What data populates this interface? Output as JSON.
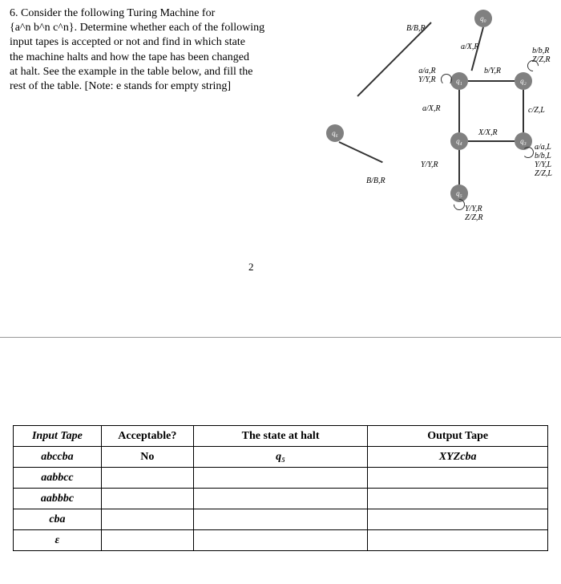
{
  "question": {
    "number": "6.",
    "text_l1": "Consider the following Turing Machine for",
    "text_l2": "{a^n b^n c^n}. Determine whether each of the following",
    "text_l3": "input tapes is accepted or not and find in which state",
    "text_l4": "the machine halts and how the tape has been changed",
    "text_l5": "at halt. See the example in the table below, and fill the",
    "text_l6": "rest of the table. [Note: e stands for empty string]"
  },
  "states": {
    "q0": "q₀",
    "q1": "q₁",
    "q2": "q₂",
    "q3": "q₃",
    "q4": "q₄",
    "q5": "q₅",
    "q6": "q₆"
  },
  "transitions": {
    "t_bbr_top": "B/B,R",
    "t_axr_top": "a/X,R",
    "t_q1_loop_a": "a/a,R",
    "t_q1_loop_b": "Y/Y,R",
    "t_byr": "b/Y,R",
    "t_q2_loop_a": "b/b,R",
    "t_q2_loop_b": "Z/Z,R",
    "t_czl": "c/Z,L",
    "t_q3_loop_a": "a/a,L",
    "t_q3_loop_b": "b/b,L",
    "t_q3_loop_c": "Y/Y,L",
    "t_q3_loop_d": "Z/Z,L",
    "t_xxr": "X/X,R",
    "t_axr_mid": "a/X,R",
    "t_yyr_mid": "Y/Y,R",
    "t_q5_loop_a": "Y/Y,R",
    "t_q5_loop_b": "Z/Z,R",
    "t_bbr_bot": "B/B,R"
  },
  "page_number": "2",
  "table": {
    "headers": {
      "input": "Input Tape",
      "accept": "Acceptable?",
      "state": "The state at halt",
      "output": "Output Tape"
    },
    "rows": [
      {
        "input": "abccba",
        "accept": "No",
        "state": "q₅",
        "output": "XYZcba"
      },
      {
        "input": "aabbcc",
        "accept": "",
        "state": "",
        "output": ""
      },
      {
        "input": "aabbbc",
        "accept": "",
        "state": "",
        "output": ""
      },
      {
        "input": "cba",
        "accept": "",
        "state": "",
        "output": ""
      },
      {
        "input": "ε",
        "accept": "",
        "state": "",
        "output": ""
      }
    ]
  }
}
